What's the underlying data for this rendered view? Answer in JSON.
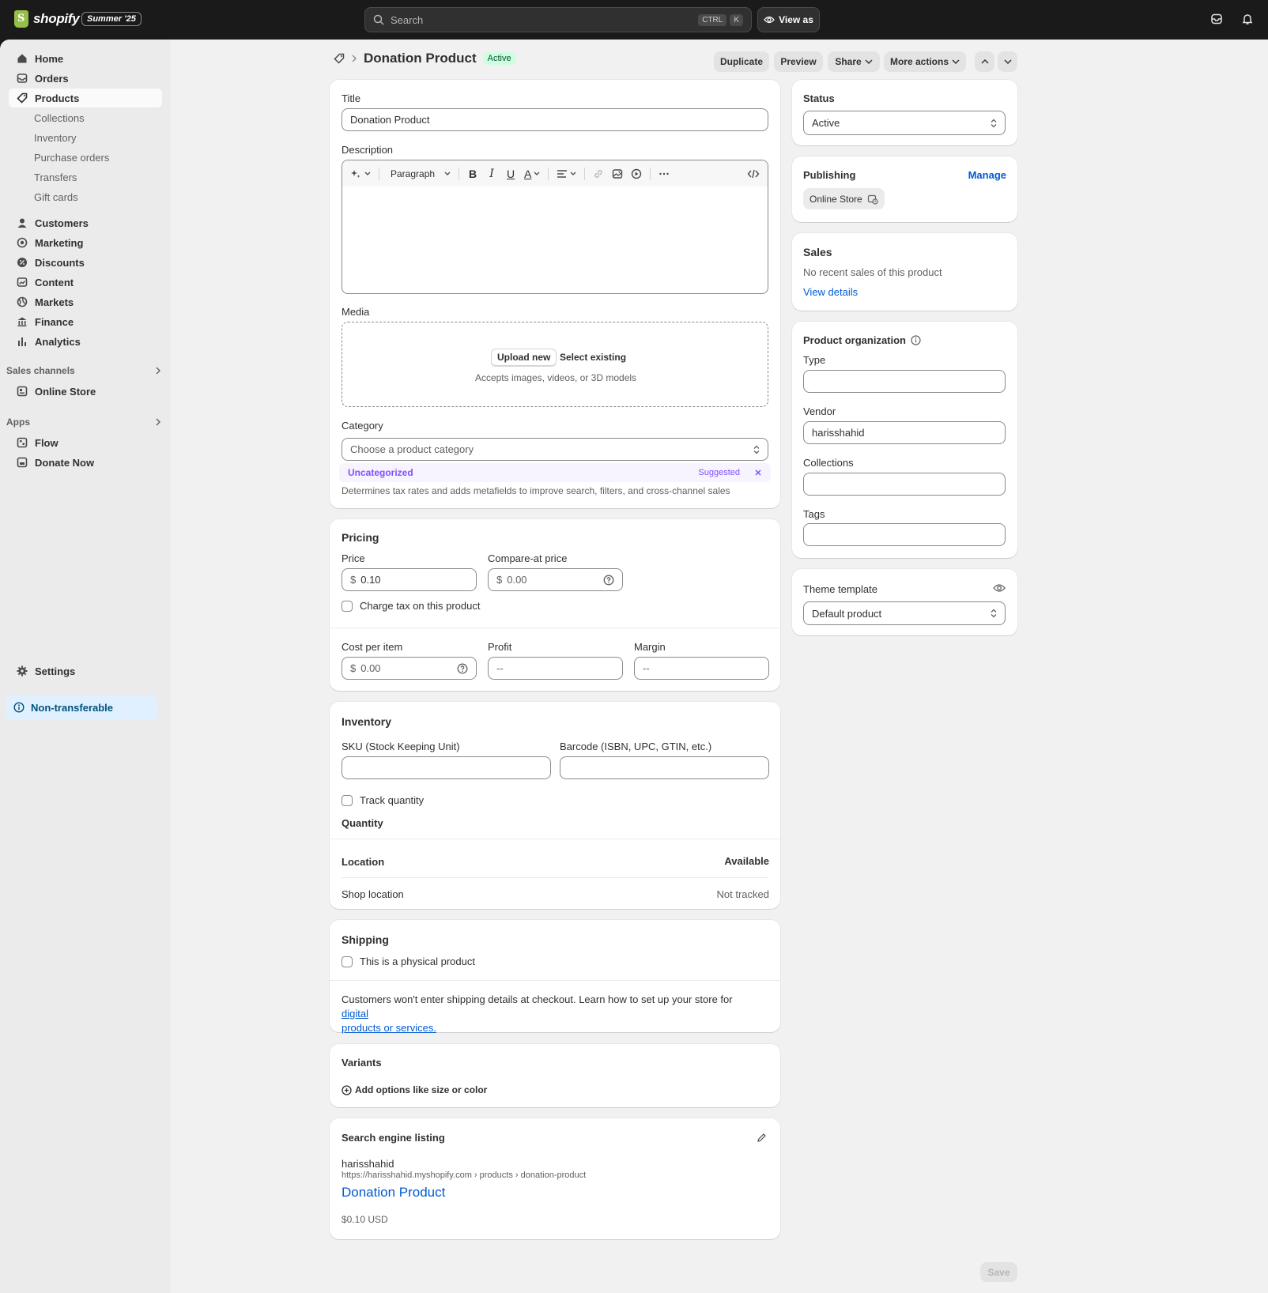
{
  "topbar": {
    "logo_text": "shopify",
    "edition": "Summer '25",
    "search_placeholder": "Search",
    "kbd1": "CTRL",
    "kbd2": "K",
    "view_as": "View as"
  },
  "sidebar": {
    "items": {
      "home": "Home",
      "orders": "Orders",
      "products": "Products",
      "collections": "Collections",
      "inventory": "Inventory",
      "purchase_orders": "Purchase orders",
      "transfers": "Transfers",
      "gift_cards": "Gift cards",
      "customers": "Customers",
      "marketing": "Marketing",
      "discounts": "Discounts",
      "content": "Content",
      "markets": "Markets",
      "finance": "Finance",
      "analytics": "Analytics"
    },
    "sales_channels_label": "Sales channels",
    "online_store": "Online Store",
    "apps_label": "Apps",
    "flow": "Flow",
    "donate_now": "Donate Now",
    "settings": "Settings",
    "non_transferable": "Non-transferable"
  },
  "header": {
    "title": "Donation Product",
    "status_badge": "Active",
    "duplicate": "Duplicate",
    "preview": "Preview",
    "share": "Share",
    "more_actions": "More actions"
  },
  "details": {
    "title_label": "Title",
    "title_value": "Donation Product",
    "description_label": "Description",
    "paragraph": "Paragraph",
    "media_label": "Media",
    "upload_new": "Upload new",
    "select_existing": "Select existing",
    "media_hint": "Accepts images, videos, or 3D models",
    "category_label": "Category",
    "category_placeholder": "Choose a product category",
    "uncategorized": "Uncategorized",
    "suggested": "Suggested",
    "category_hint": "Determines tax rates and adds metafields to improve search, filters, and cross-channel sales"
  },
  "pricing": {
    "heading": "Pricing",
    "price_label": "Price",
    "currency": "$",
    "price_value": "0.10",
    "compare_label": "Compare-at price",
    "compare_placeholder": "0.00",
    "charge_tax": "Charge tax on this product",
    "cost_label": "Cost per item",
    "cost_placeholder": "0.00",
    "profit_label": "Profit",
    "profit_value": "--",
    "margin_label": "Margin",
    "margin_value": "--"
  },
  "inventory": {
    "heading": "Inventory",
    "sku_label": "SKU (Stock Keeping Unit)",
    "barcode_label": "Barcode (ISBN, UPC, GTIN, etc.)",
    "track_quantity": "Track quantity",
    "quantity_heading": "Quantity",
    "location_col": "Location",
    "available_col": "Available",
    "shop_location": "Shop location",
    "not_tracked": "Not tracked"
  },
  "shipping": {
    "heading": "Shipping",
    "physical": "This is a physical product",
    "note": "Customers won't enter shipping details at checkout. Learn how to set up your store for ",
    "note_link1": "digital",
    "note_link2": "products or services."
  },
  "variants": {
    "heading": "Variants",
    "add_options": "Add options like size or color"
  },
  "seo": {
    "heading": "Search engine listing",
    "store": "harisshahid",
    "url": "https://harisshahid.myshopify.com › products › donation-product",
    "title": "Donation Product",
    "price": "$0.10 USD"
  },
  "status_card": {
    "heading": "Status",
    "value": "Active"
  },
  "publishing": {
    "heading": "Publishing",
    "manage": "Manage",
    "channel": "Online Store"
  },
  "sales": {
    "heading": "Sales",
    "text": "No recent sales of this product",
    "view_details": "View details"
  },
  "organization": {
    "heading": "Product organization",
    "type_label": "Type",
    "vendor_label": "Vendor",
    "vendor_value": "harisshahid",
    "collections_label": "Collections",
    "tags_label": "Tags"
  },
  "theme": {
    "heading": "Theme template",
    "value": "Default product"
  },
  "footer": {
    "save": "Save"
  }
}
